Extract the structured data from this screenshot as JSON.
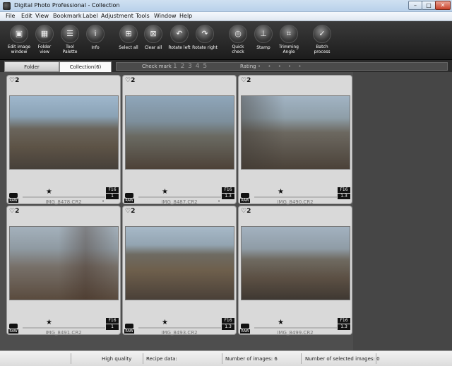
{
  "window": {
    "title": "Digital Photo Professional - Collection"
  },
  "menu": [
    "File",
    "Edit",
    "View",
    "Bookmark",
    "Label",
    "Adjustment",
    "Tools",
    "Window",
    "Help"
  ],
  "toolbar": [
    {
      "label": "Edit image\nwindow",
      "icon": "edit-window-icon"
    },
    {
      "label": "Folder\nview",
      "icon": "folder-view-icon"
    },
    {
      "label": "Tool\nPalette",
      "icon": "tool-palette-icon"
    },
    {
      "label": "Info",
      "icon": "info-icon"
    },
    {
      "label": "Select all",
      "icon": "select-all-icon"
    },
    {
      "label": "Clear all",
      "icon": "clear-all-icon"
    },
    {
      "label": "Rotate left",
      "icon": "rotate-left-icon"
    },
    {
      "label": "Rotate right",
      "icon": "rotate-right-icon"
    },
    {
      "label": "Quick\ncheck",
      "icon": "quick-check-icon"
    },
    {
      "label": "Stamp",
      "icon": "stamp-icon"
    },
    {
      "label": "Trimming\nAngle",
      "icon": "trimming-icon"
    },
    {
      "label": "Batch\nprocess",
      "icon": "batch-process-icon"
    }
  ],
  "tabs": {
    "folder": "Folder",
    "collection": "Collection(6)"
  },
  "filter": {
    "check_mark": "Check mark",
    "numbers": "1 2 3 4 5",
    "rating": "Rating",
    "dots": "• • • • •"
  },
  "thumbnails": [
    {
      "badge": "♡2",
      "filename": "IMG_8478.CR2",
      "fstop": "F16",
      "zoom": "1",
      "dot": "•"
    },
    {
      "badge": "♡2",
      "filename": "IMG_8487.CR2",
      "fstop": "F16",
      "zoom": "1.3",
      "dot": "•"
    },
    {
      "badge": "♡2",
      "filename": "IMG_8490.CR2",
      "fstop": "F16",
      "zoom": "1.3",
      "dot": ""
    },
    {
      "badge": "♡2",
      "filename": "IMG_8491.CR2",
      "fstop": "F16",
      "zoom": "1",
      "dot": ""
    },
    {
      "badge": "♡2",
      "filename": "IMG_8493.CR2",
      "fstop": "F16",
      "zoom": "1.3",
      "dot": ""
    },
    {
      "badge": "♡2",
      "filename": "IMG_8499.CR2",
      "fstop": "F16",
      "zoom": "1.3",
      "dot": ""
    }
  ],
  "status": {
    "quality": "High quality",
    "recipe": "Recipe data:",
    "images": "Number of images: 6",
    "selected": "Number of selected images: 0"
  }
}
